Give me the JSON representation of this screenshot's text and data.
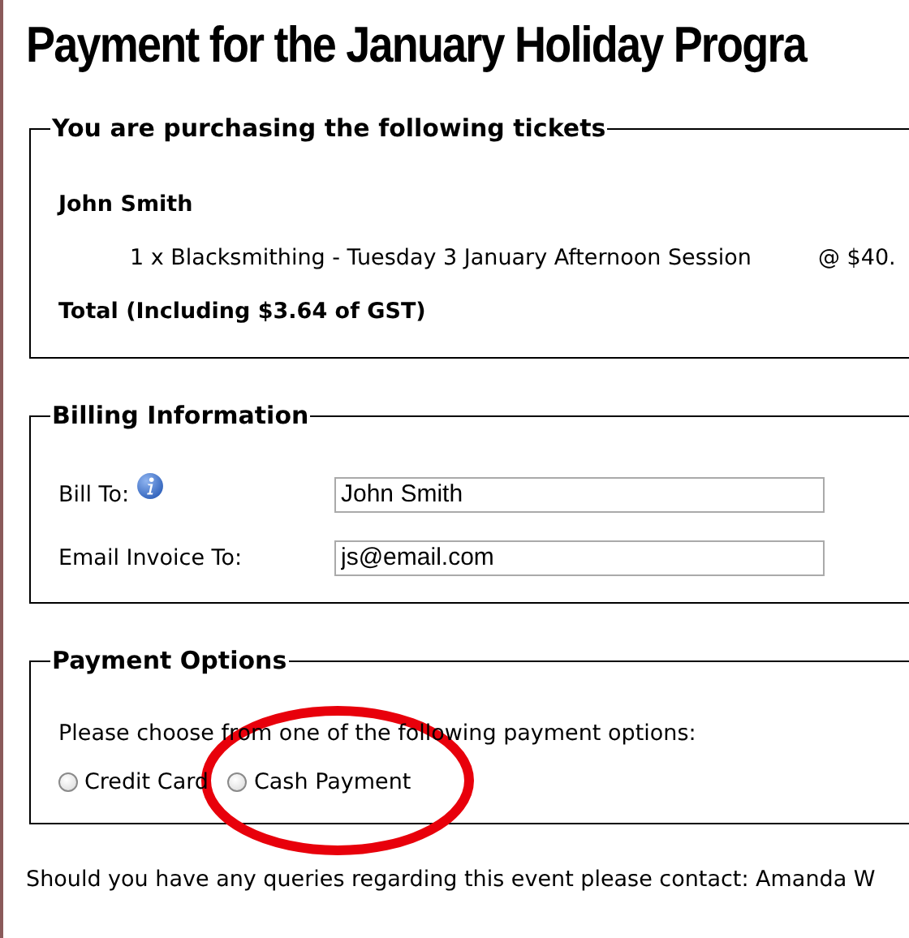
{
  "title": "Payment for the January Holiday Progra",
  "tickets": {
    "legend": "You are purchasing the following tickets",
    "attendee": "John Smith",
    "items": [
      {
        "description": "1 x Blacksmithing - Tuesday 3 January Afternoon Session",
        "price": "@ $40."
      }
    ],
    "total": "Total (Including $3.64 of GST)"
  },
  "billing": {
    "legend": "Billing Information",
    "fields": [
      {
        "label": "Bill To:",
        "info": true,
        "value": "John Smith"
      },
      {
        "label": "Email Invoice To:",
        "info": false,
        "value": "js@email.com"
      }
    ]
  },
  "payment": {
    "legend": "Payment Options",
    "prompt": "Please choose from one of the following payment options:",
    "options": [
      {
        "label": "Credit Card",
        "selected": false
      },
      {
        "label": "Cash Payment",
        "selected": false
      }
    ]
  },
  "annotations": [
    {
      "kind": "ellipse"
    }
  ],
  "footer": "Should you have any queries regarding this event please contact: Amanda W"
}
